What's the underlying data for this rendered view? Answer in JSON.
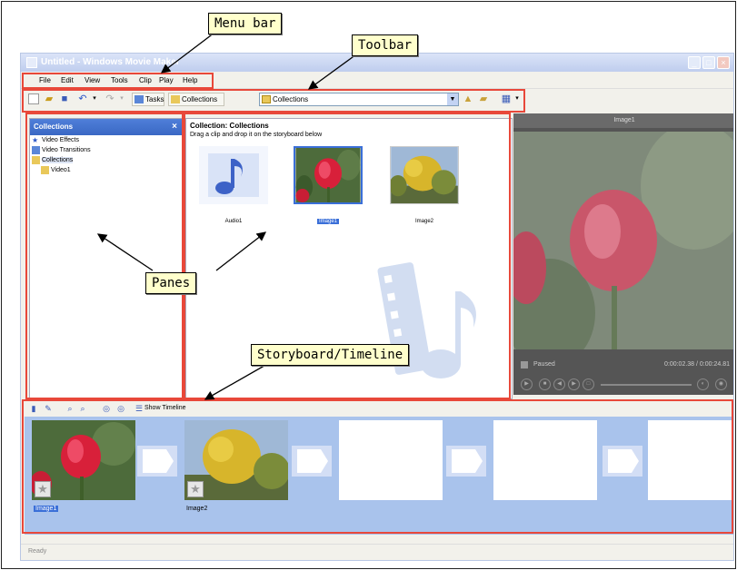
{
  "window": {
    "title": "Untitled - Windows Movie Maker",
    "status_text": "Ready"
  },
  "menu": {
    "items": [
      "File",
      "Edit",
      "View",
      "Tools",
      "Clip",
      "Play",
      "Help"
    ]
  },
  "toolbar": {
    "tasks_label": "Tasks",
    "collections_label": "Collections",
    "collection_select_value": "Collections"
  },
  "collections_pane": {
    "header": "Collections",
    "close_glyph": "×",
    "tree": [
      "Video Effects",
      "Video Transitions",
      "Collections",
      "Video1"
    ]
  },
  "contents": {
    "title": "Collection: Collections",
    "subtitle": "Drag a clip and drop it on the storyboard below",
    "clips": [
      {
        "label": "Audio1",
        "kind": "audio",
        "selected": false
      },
      {
        "label": "Image1",
        "kind": "tulip",
        "selected": true
      },
      {
        "label": "Image2",
        "kind": "tree",
        "selected": false
      }
    ]
  },
  "monitor": {
    "title": "Image1",
    "status_left": "Paused",
    "time": "0:00:02.38 / 0:00:24.81"
  },
  "storyboard": {
    "show_timeline_label": "Show Timeline",
    "slots": [
      {
        "label": "Image1",
        "kind": "tulip",
        "selected": true
      },
      {
        "label": "Image2",
        "kind": "tree",
        "selected": false
      },
      {
        "label": "",
        "kind": "empty",
        "selected": false
      },
      {
        "label": "",
        "kind": "empty",
        "selected": false
      },
      {
        "label": "",
        "kind": "empty",
        "selected": false
      }
    ]
  },
  "callouts": {
    "menu_bar": "Menu bar",
    "toolbar": "Toolbar",
    "panes": "Panes",
    "storyboard": "Storyboard/Timeline"
  },
  "colors": {
    "highlight": "#e8483a",
    "callout_bg": "#ffffcc",
    "selection": "#3a6fd8"
  }
}
